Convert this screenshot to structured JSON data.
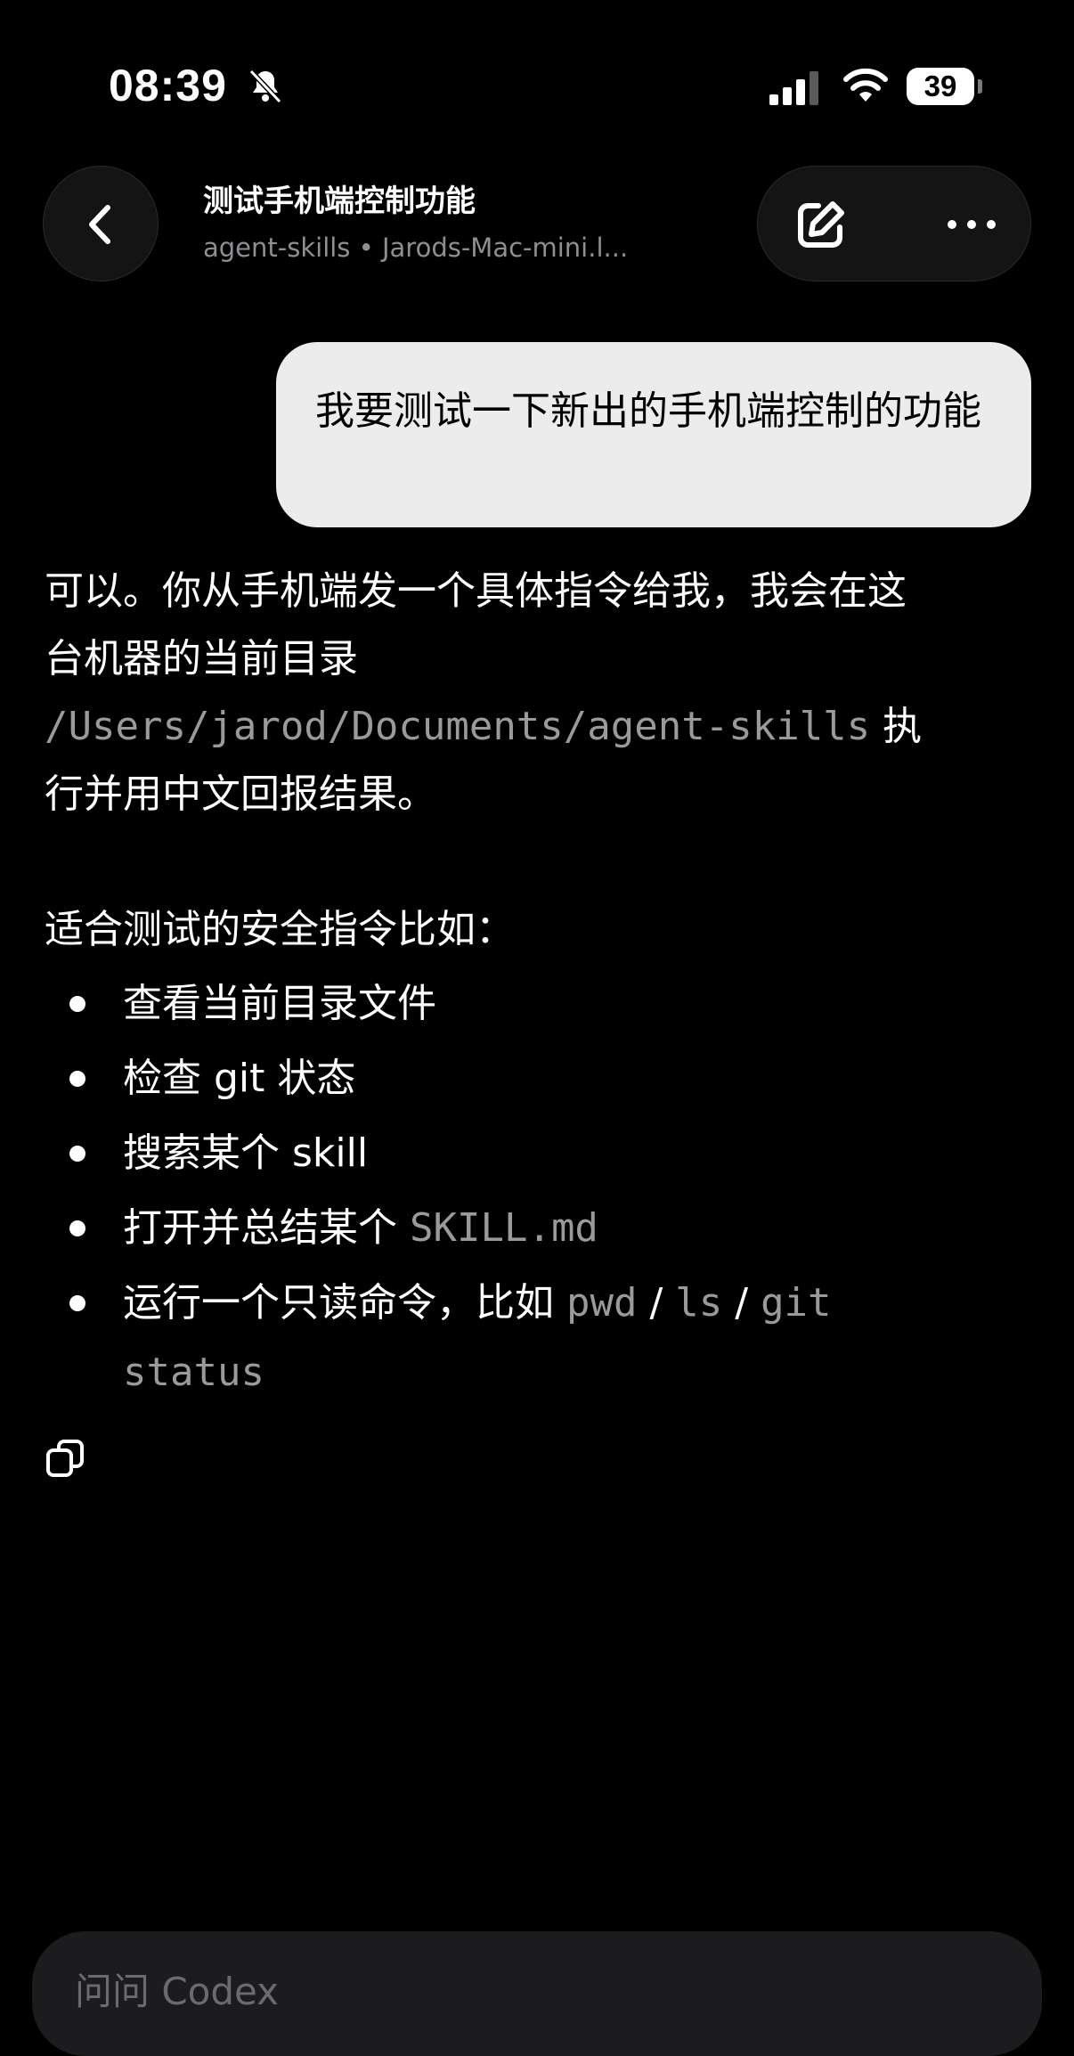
{
  "status_bar": {
    "time": "08:39",
    "battery": "39",
    "icons": [
      "bell-slash-icon",
      "cellular-signal-icon",
      "wifi-icon",
      "battery-icon"
    ]
  },
  "header": {
    "title": "测试手机端控制功能",
    "subtitle": "agent-skills • Jarods-Mac-mini.l...",
    "icons": [
      "chevron-left-icon",
      "compose-icon",
      "more-icon"
    ]
  },
  "conversation": {
    "user_message": "我要测试一下新出的手机端控制的功能",
    "assistant": {
      "intro_1": "可以。你从手机端发一个具体指令给我，我会在这台机器的当前目录 ",
      "intro_path": "/Users/jarod/Documents/agent-skills",
      "intro_2": " 执行并用中文回报结果。",
      "list_heading": "适合测试的安全指令比如：",
      "items": [
        {
          "text": "查看当前目录文件"
        },
        {
          "text": "检查 git 状态"
        },
        {
          "text": "搜索某个 skill"
        },
        {
          "text": "打开并总结某个 ",
          "code": "SKILL.md"
        },
        {
          "text": "运行一个只读命令，比如 ",
          "code1": "pwd",
          "sep1": " / ",
          "code2": "ls",
          "sep2": " / ",
          "code3": "git status"
        }
      ],
      "copy_icon": "copy-icon"
    }
  },
  "composer": {
    "placeholder": "问问 Codex"
  }
}
